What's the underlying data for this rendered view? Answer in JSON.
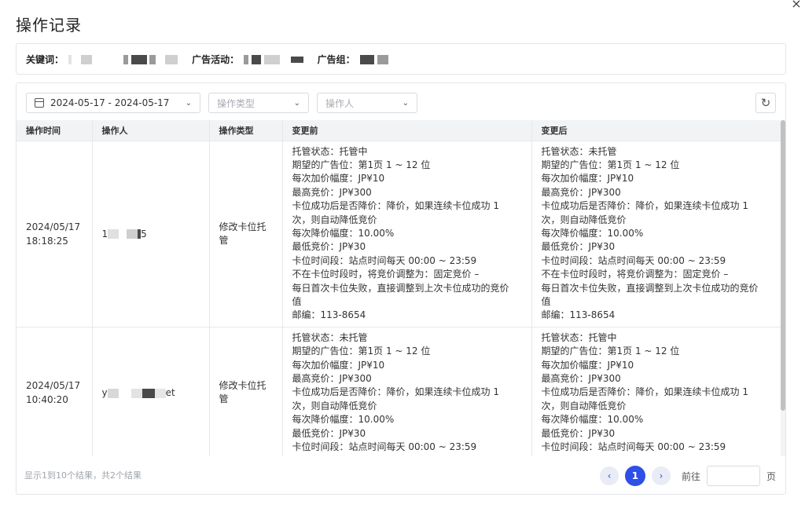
{
  "modal": {
    "title": "操作记录",
    "close_glyph": "×"
  },
  "info": {
    "keyword_label": "关键词：",
    "campaign_label": "广告活动：",
    "adgroup_label": "广告组："
  },
  "filters": {
    "date_range": "2024-05-17 - 2024-05-17",
    "op_type_placeholder": "操作类型",
    "operator_placeholder": "操作人"
  },
  "table": {
    "columns": [
      "操作时间",
      "操作人",
      "操作类型",
      "变更前",
      "变更后"
    ],
    "rows": [
      {
        "date": "2024/05/17",
        "time": "18:18:25",
        "operator_prefix": "1",
        "operator_suffix": "5",
        "op_type": "修改卡位托管",
        "before": [
          "托管状态：托管中",
          "期望的广告位：第1页 1 ~ 12 位",
          "每次加价幅度：JP¥10",
          "最高竞价：JP¥300",
          "卡位成功后是否降价：降价，如果连续卡位成功 1",
          "次，则自动降低竞价",
          "每次降价幅度：10.00%",
          "最低竞价：JP¥30",
          "卡位时间段：站点时间每天 00:00 ~ 23:59",
          "不在卡位时段时，将竞价调整为：固定竞价 –",
          "每日首次卡位失败，直接调整到上次卡位成功的竞价",
          "值",
          "邮编：113-8654"
        ],
        "after": [
          "托管状态：未托管",
          "期望的广告位：第1页 1 ~ 12 位",
          "每次加价幅度：JP¥10",
          "最高竞价：JP¥300",
          "卡位成功后是否降价：降价，如果连续卡位成功 1",
          "次，则自动降低竞价",
          "每次降价幅度：10.00%",
          "最低竞价：JP¥30",
          "卡位时间段：站点时间每天 00:00 ~ 23:59",
          "不在卡位时段时，将竞价调整为：固定竞价 –",
          "每日首次卡位失败，直接调整到上次卡位成功的竞价",
          "值",
          "邮编：113-8654"
        ]
      },
      {
        "date": "2024/05/17",
        "time": "10:40:20",
        "operator_prefix": "y",
        "operator_suffix": "et",
        "op_type": "修改卡位托管",
        "before": [
          "托管状态：未托管",
          "期望的广告位：第1页 1 ~ 12 位",
          "每次加价幅度：JP¥10",
          "最高竞价：JP¥300",
          "卡位成功后是否降价：降价，如果连续卡位成功 1",
          "次，则自动降低竞价",
          "每次降价幅度：10.00%",
          "最低竞价：JP¥30",
          "卡位时间段：站点时间每天 00:00 ~ 23:59"
        ],
        "after": [
          "托管状态：托管中",
          "期望的广告位：第1页 1 ~ 12 位",
          "每次加价幅度：JP¥10",
          "最高竞价：JP¥300",
          "卡位成功后是否降价：降价，如果连续卡位成功 1",
          "次，则自动降低竞价",
          "每次降价幅度：10.00%",
          "最低竞价：JP¥30",
          "卡位时间段：站点时间每天 00:00 ~ 23:59"
        ]
      }
    ]
  },
  "footer": {
    "summary": "显示1到10个结果，共2个结果",
    "prev_glyph": "‹",
    "current_page": "1",
    "next_glyph": "›",
    "goto_label": "前往",
    "page_suffix": "页"
  }
}
